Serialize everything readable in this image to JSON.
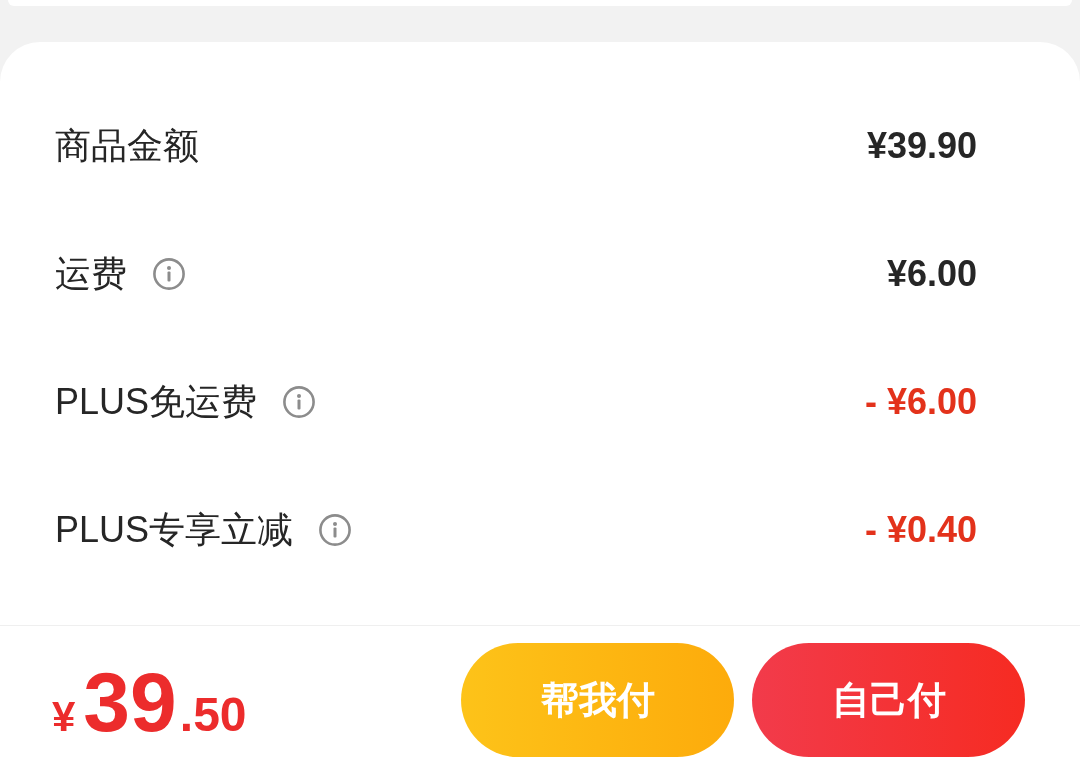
{
  "rows": [
    {
      "label": "商品金额",
      "info": false,
      "value": "¥39.90",
      "kind": "charge"
    },
    {
      "label": "运费",
      "info": true,
      "value": "¥6.00",
      "kind": "charge"
    },
    {
      "label": "PLUS免运费",
      "info": true,
      "value": "- ¥6.00",
      "kind": "discount"
    },
    {
      "label": "PLUS专享立减",
      "info": true,
      "value": "- ¥0.40",
      "kind": "discount"
    }
  ],
  "footer": {
    "total": {
      "currency": "¥",
      "integer": "39",
      "fraction": ".50"
    },
    "buttons": [
      {
        "label": "帮我付",
        "kind": "secondary"
      },
      {
        "label": "自己付",
        "kind": "primary"
      }
    ]
  }
}
